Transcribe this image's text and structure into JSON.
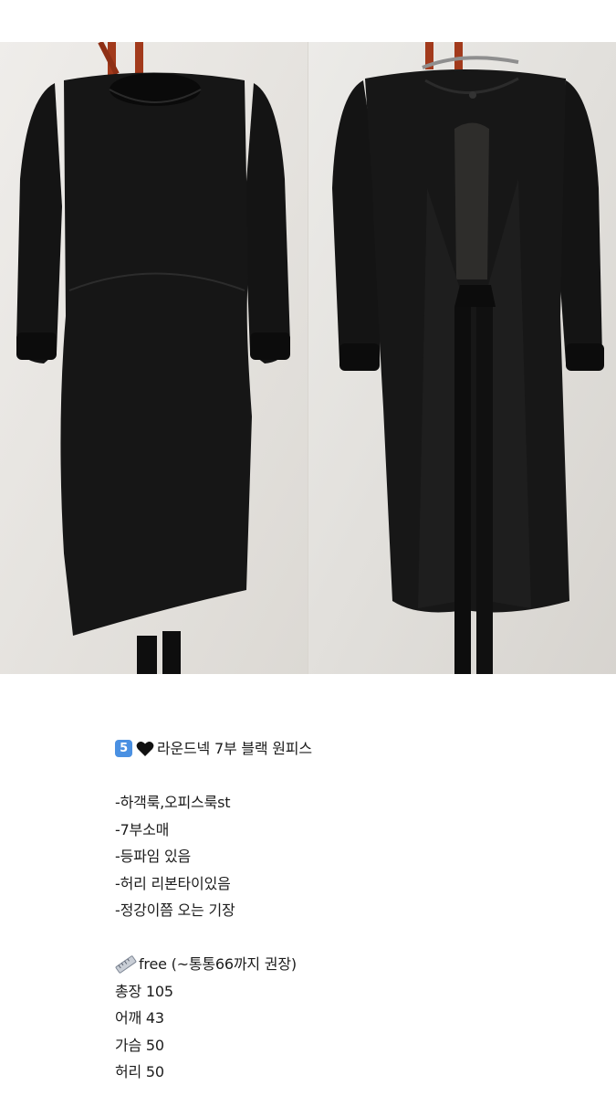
{
  "listing": {
    "photos": [
      {
        "name": "front-view",
        "alt": "black dress front"
      },
      {
        "name": "back-view",
        "alt": "black dress back"
      }
    ],
    "title_number": "5",
    "title_text": "라운드넥 7부 블랙 원피스",
    "features": [
      "-하객룩,오피스룩st",
      "-7부소매",
      "-등파임 있음",
      "-허리 리본타이있음",
      "-정강이쯤 오는 기장"
    ],
    "size_label": "free (~통통66까지 권장)",
    "measurements": [
      "총장 105",
      "어깨 43",
      "가슴 50",
      "허리 50"
    ]
  }
}
